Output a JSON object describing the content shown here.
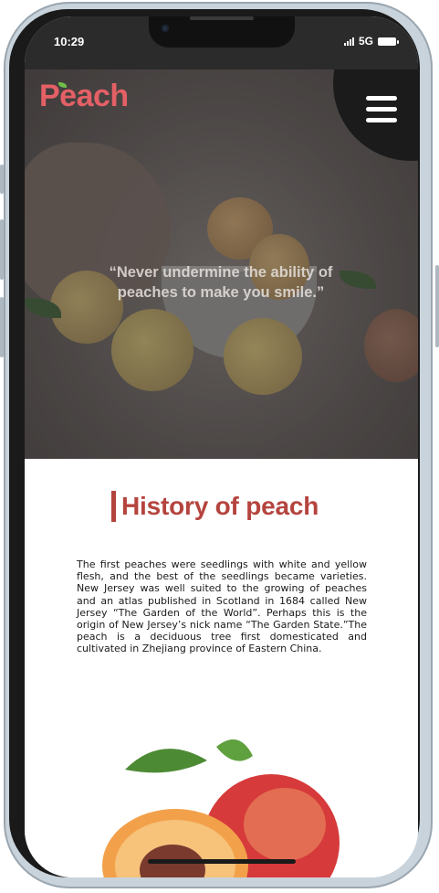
{
  "status_bar": {
    "time": "10:29",
    "network": "5G"
  },
  "header": {
    "logo": "Peach",
    "menu_icon": "hamburger-menu-icon"
  },
  "hero": {
    "quote": "“Never undermine the ability of peaches to make you smile.”"
  },
  "history": {
    "title": "History of peach",
    "body": "The first peaches were seedlings with white and yellow flesh, and the best of the seedlings became varieties. New Jersey was well suited to the growing of peaches and an atlas published in Scotland in 1684 called New Jersey “The Garden of the World”. Perhaps this is the origin of New Jersey’s nick name “The Garden State.”The peach is a deciduous tree first domesticated and cultivated in Zhejiang province of Eastern China."
  },
  "colors": {
    "brand": "#e46066",
    "accent": "#b5443e",
    "status_bar": "#2b2b2b"
  }
}
